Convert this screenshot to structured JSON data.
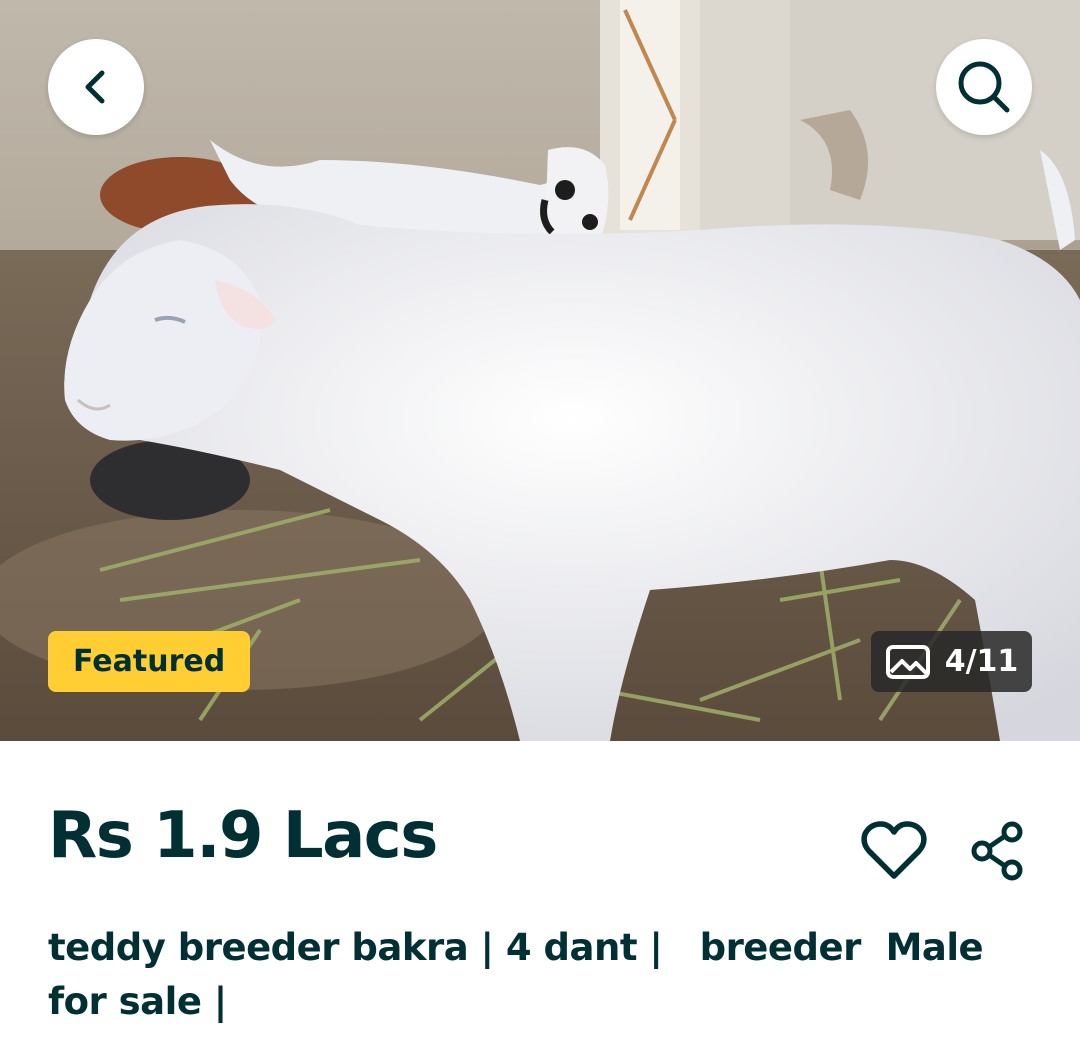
{
  "listing": {
    "price": "Rs 1.9 Lacs",
    "title": "teddy breeder bakra | 4 dant |   breeder  Male for sale |"
  },
  "gallery": {
    "badge_label": "Featured",
    "counter": "4/11",
    "image_subject": "white goat in a barn"
  },
  "icons": {
    "back": "chevron-left-icon",
    "search": "search-icon",
    "gallery": "image-icon",
    "favorite": "heart-icon",
    "share": "share-icon"
  },
  "colors": {
    "text_primary": "#002f34",
    "featured_badge": "#ffce32",
    "counter_badge_bg": "#282828",
    "button_bg": "#ffffff"
  }
}
